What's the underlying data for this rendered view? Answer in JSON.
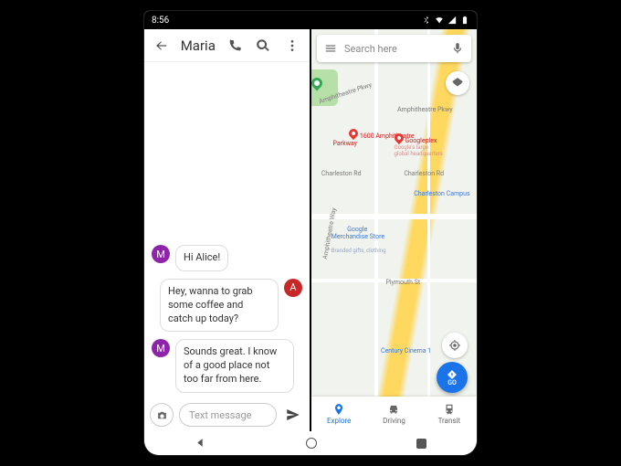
{
  "statusbar": {
    "time": "8:56"
  },
  "messages": {
    "contact_name": "Maria",
    "thread": [
      {
        "from": "them",
        "avatar": "M",
        "text": "Hi Alice!"
      },
      {
        "from": "me",
        "avatar": "A",
        "text": "Hey, wanna to grab some coffee and catch up today?"
      },
      {
        "from": "them",
        "avatar": "M",
        "text": "Sounds great. I know of a good place not too far from here."
      }
    ],
    "compose_placeholder": "Text message"
  },
  "maps": {
    "search_placeholder": "Search here",
    "go_label": "GO",
    "tabs": [
      {
        "label": "Explore",
        "active": true
      },
      {
        "label": "Driving",
        "active": false
      },
      {
        "label": "Transit",
        "active": false
      }
    ],
    "labels": {
      "amphitheatre_pkwy": "Amphitheatre Pkwy",
      "amphitheatre_pkwy2": "Amphitheatre Pkwy",
      "addr_1600": "1600 Amphitheatre\nParkway",
      "googleplex": "Googleplex",
      "googleplex_sub": "Google's large\nglobal headquarters",
      "charleston_rd": "Charleston Rd",
      "charleston_rd2": "Charleston Rd",
      "charleston_campus": "Charleston Campus",
      "merch_store": "Google\nMerchandise Store",
      "merch_store_sub": "Branded gifts, clothing",
      "amphitheatre_way": "Amphitheatre Way",
      "plymouth_st": "Plymouth St",
      "century_cinema": "Century Cinema 1"
    }
  }
}
